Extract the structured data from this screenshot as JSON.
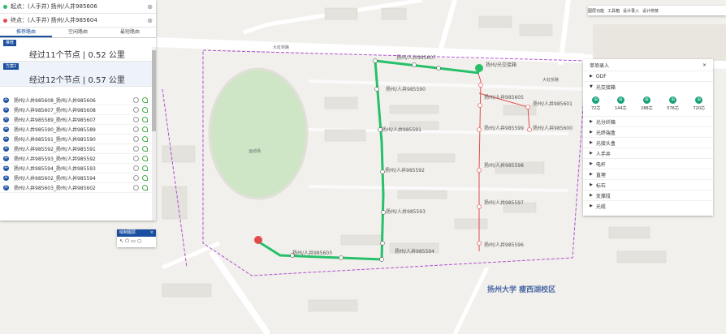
{
  "start": {
    "label": "起点：(人手井) 扬州/人井985606"
  },
  "end": {
    "label": "终点：(人手井) 扬州/人井985604"
  },
  "tabs": [
    "推荐路由",
    "空闲路由",
    "最短路由"
  ],
  "plans": [
    {
      "tag": "推荐",
      "summary": "经过11个节点 | 0.52 公里"
    },
    {
      "tag": "方案2",
      "summary": "经过12个节点 | 0.57 公里"
    }
  ],
  "nodes": [
    "扬州/人井985608_扬州/人井985606",
    "扬州/人井985607_扬州/人井985608",
    "扬州/人井985589_扬州/人井985607",
    "扬州/人井985590_扬州/人井985589",
    "扬州/人井985591_扬州/人井985590",
    "扬州/人井985592_扬州/人井985591",
    "扬州/人井985593_扬州/人井985592",
    "扬州/人井985594_扬州/人井985593",
    "扬州/人井985602_扬州/人井985594",
    "扬州/人井985603_扬州/人井985602"
  ],
  "right_panel": {
    "title": "单项录入",
    "categories": [
      "ODF",
      "光交接箱"
    ],
    "sub_items": [
      "72芯",
      "144芯",
      "288芯",
      "576芯",
      "720芯"
    ],
    "more_categories": [
      "光分纤箱",
      "光终端盒",
      "光接头盒",
      "人手井",
      "电杆",
      "直埋",
      "标石",
      "支撑段",
      "光缆"
    ]
  },
  "toolbar": [
    "图层功能",
    "工具箱",
    "设计录入",
    "设计校核"
  ],
  "draw_tool": {
    "title": "绘制图层",
    "icons": [
      "pointer-icon",
      "polygon-icon",
      "rect-icon",
      "circle-icon"
    ]
  },
  "map_labels": {
    "road1": "大虹桥路",
    "road2": "大虹桥路",
    "campus": "扬州大学 瘦西湖校区",
    "stadium": "运动场"
  },
  "route_labels": [
    "扬州/人井985607",
    "扬州/人井985590",
    "扬州/人井985591",
    "扬州/人井985592",
    "扬州/人井985593",
    "扬州/人井985594",
    "扬州/人井985603",
    "扬州/光交接箱",
    "扬州/人井985605",
    "扬州/人井985599",
    "扬州/人井985598",
    "扬州/人井985597",
    "扬州/人井985596",
    "扬州/人井985601",
    "扬州/人井985600"
  ]
}
